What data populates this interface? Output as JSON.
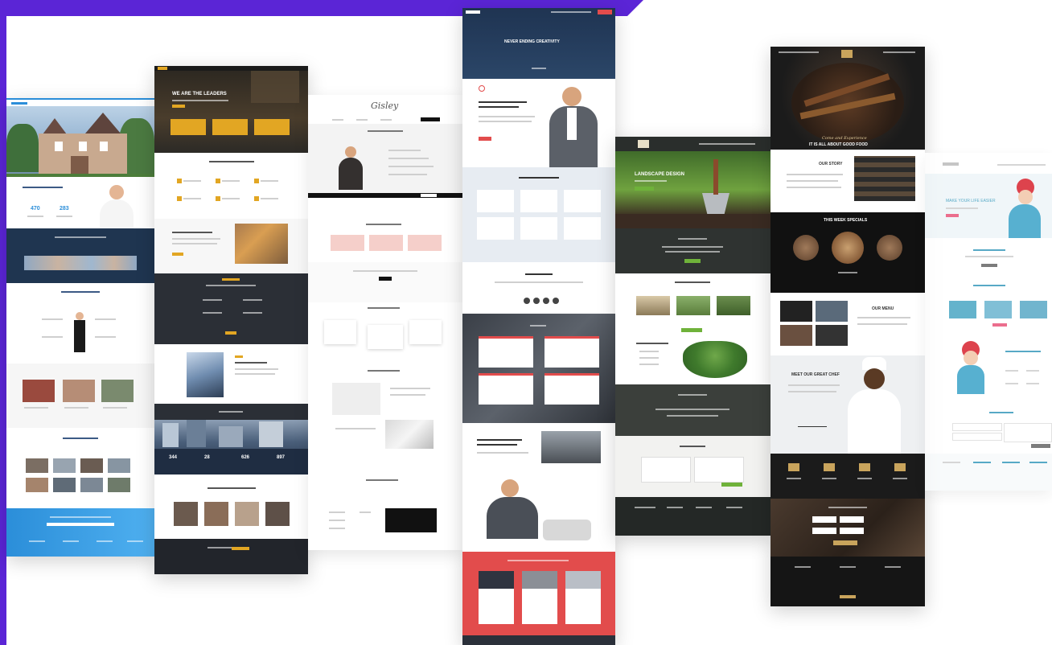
{
  "colors": {
    "accent_purple": "#5b25d6",
    "realestate_blue": "#2b8ed9",
    "corporate_gold": "#e2a623",
    "creative_red": "#e24c4c",
    "landscape_green": "#6fb23a",
    "restaurant_dark": "#1b1b1b"
  },
  "templates": [
    {
      "name": "real-estate",
      "texts": {
        "stat_left": "470",
        "stat_right": "283"
      }
    },
    {
      "name": "corporate",
      "texts": {
        "hero_heading": "WE ARE THE LEADERS",
        "stats": [
          "344",
          "28",
          "626",
          "897"
        ]
      }
    },
    {
      "name": "personal",
      "texts": {
        "logo": "Gisley"
      }
    },
    {
      "name": "creative",
      "texts": {
        "hero_heading": "NEVER ENDING CREATIVITY"
      }
    },
    {
      "name": "landscape",
      "texts": {
        "hero_heading": "LANDSCAPE DESIGN"
      }
    },
    {
      "name": "restaurant",
      "texts": {
        "hero_script": "Come and Experience",
        "hero_heading": "IT IS ALL ABOUT GOOD FOOD",
        "about_heading": "OUR STORY",
        "specials_heading": "THIS WEEK SPECIALS",
        "menu_heading": "OUR MENU",
        "chef_heading": "MEET OUR GREAT CHEF"
      }
    },
    {
      "name": "beauty",
      "texts": {
        "hero_heading": "MAKE YOUR LIFE EASIER"
      }
    }
  ]
}
